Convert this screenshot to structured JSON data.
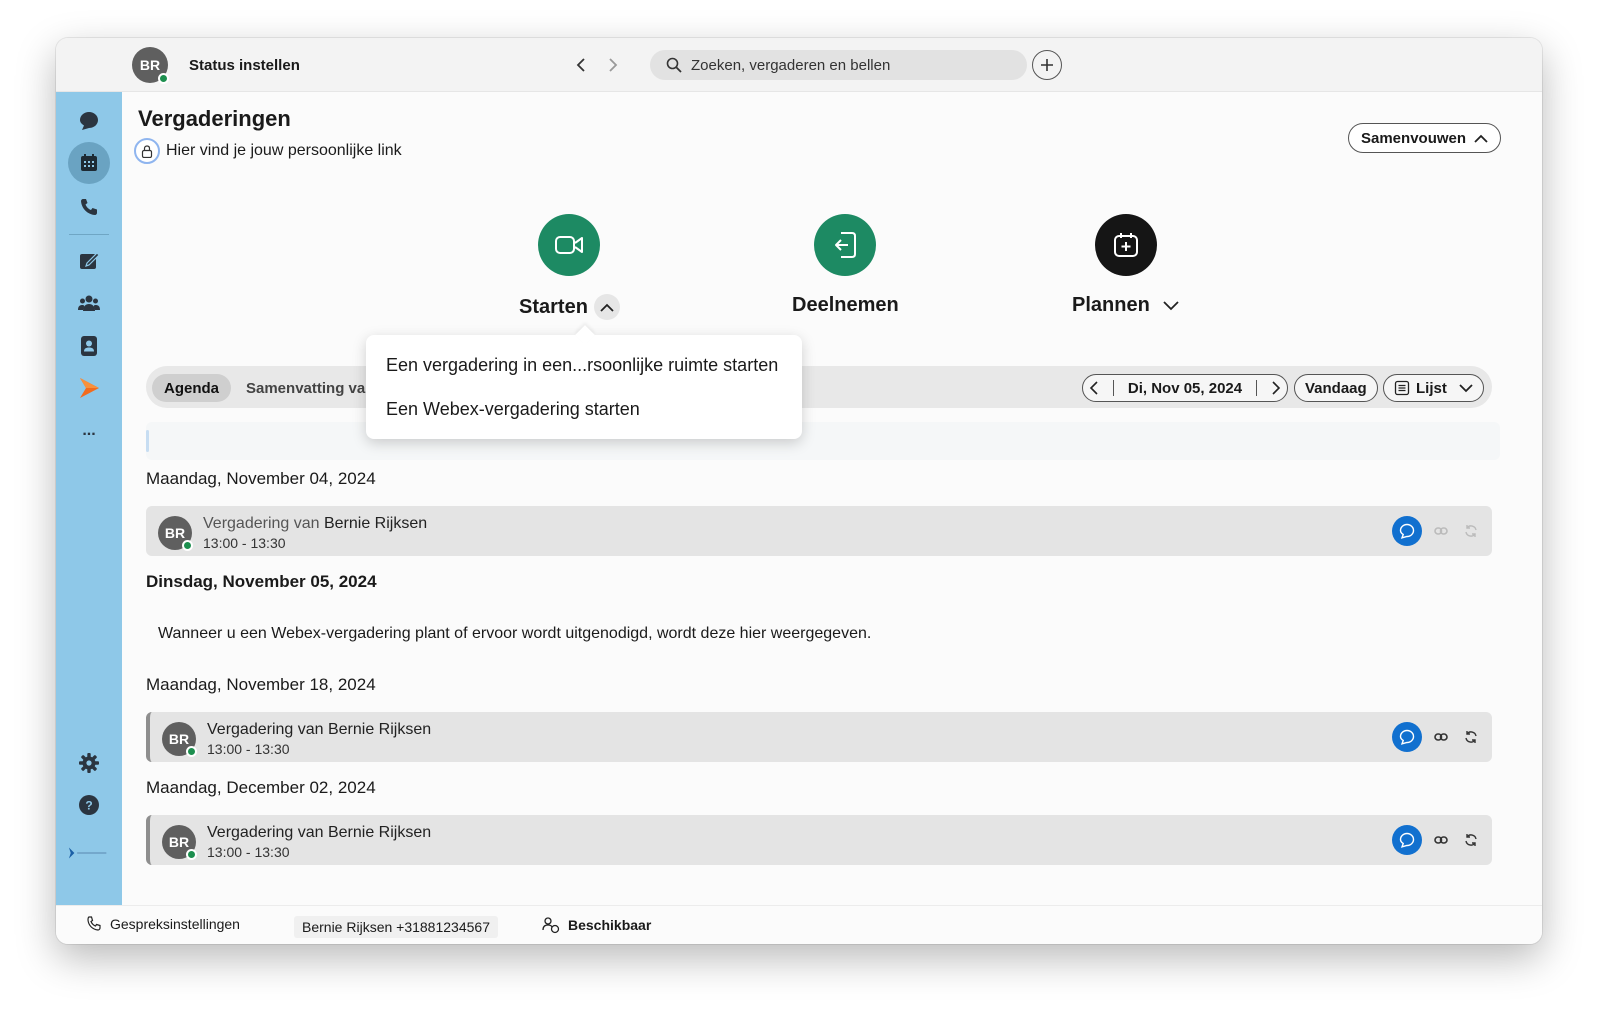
{
  "titlebar": {
    "avatar_initials": "BR",
    "status_label": "Status instellen",
    "search_placeholder": "Zoeken, vergaderen en bellen"
  },
  "sidebar": {
    "items": [
      "messaging-icon",
      "calendar-icon",
      "phone-icon",
      "whiteboard-icon",
      "teams-icon",
      "contacts-icon",
      "webex-app-icon",
      "more-icon",
      "settings-icon",
      "help-icon",
      "brand-logo"
    ],
    "more_label": "..."
  },
  "main": {
    "title": "Vergaderingen",
    "personal_link": "Hier vind je jouw persoonlijke link",
    "collapse_label": "Samenvouwen",
    "actions": {
      "start": "Starten",
      "join": "Deelnemen",
      "schedule": "Plannen"
    },
    "start_menu": [
      "Een vergadering in een...rsoonlijke ruimte starten",
      "Een Webex-vergadering starten"
    ],
    "tabs": [
      "Agenda",
      "Samenvatting var"
    ],
    "date_label": "Di, Nov 05, 2024",
    "today_label": "Vandaag",
    "view_label": "Lijst",
    "days": [
      {
        "heading": "Maandag, November 04, 2024",
        "meeting": {
          "prefix": "Vergadering van",
          "host": "Bernie Rijksen",
          "time": "13:00  -  13:30",
          "initials": "BR"
        }
      },
      {
        "heading": "Dinsdag, November 05, 2024",
        "empty_message": "Wanneer u een Webex-vergadering plant of ervoor wordt uitgenodigd, wordt deze hier weergegeven."
      },
      {
        "heading": "Maandag, November 18, 2024",
        "meeting": {
          "title": "Vergadering van Bernie Rijksen",
          "time": "13:00  -  13:30",
          "initials": "BR"
        }
      },
      {
        "heading": "Maandag, December 02, 2024",
        "meeting": {
          "title": "Vergadering van Bernie Rijksen",
          "time": "13:00  -  13:30",
          "initials": "BR"
        }
      }
    ]
  },
  "footer": {
    "call_settings": "Gespreksinstellingen",
    "user_number": "Bernie Rijksen +31881234567",
    "availability": "Beschikbaar"
  },
  "colors": {
    "sidebar": "#8ec8e8",
    "start_button": "#1d8a63",
    "join_button": "#1d8a63",
    "schedule_button": "#151515",
    "chat_button": "#1170cf",
    "presence": "#1d8f4f"
  }
}
